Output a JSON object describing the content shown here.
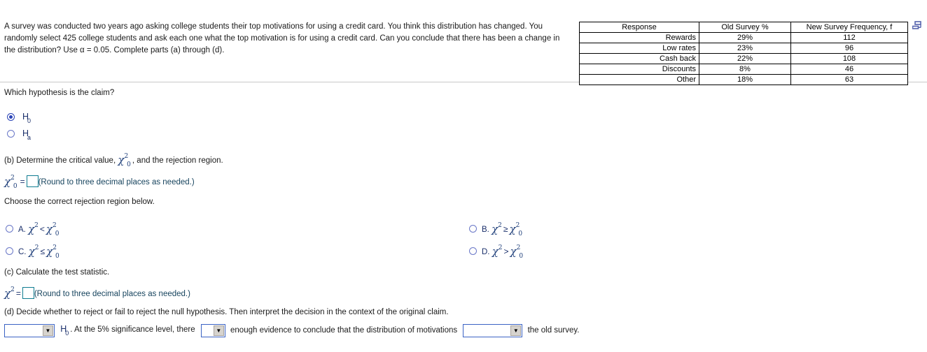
{
  "problem": {
    "statement": "A survey was conducted two years ago asking college students their top motivations for using a credit card. You think this distribution has changed. You randomly select 425 college students and ask each one what the top motivation is for using a credit card. Can you conclude that there has been a change in the distribution? Use α = 0.05. Complete parts (a) through (d)."
  },
  "table": {
    "headers": [
      "Response",
      "Old Survey %",
      "New Survey  Frequency, f"
    ],
    "rows": [
      {
        "response": "Rewards",
        "old_pct": "29%",
        "new_freq": "112"
      },
      {
        "response": "Low rates",
        "old_pct": "23%",
        "new_freq": "96"
      },
      {
        "response": "Cash back",
        "old_pct": "22%",
        "new_freq": "108"
      },
      {
        "response": "Discounts",
        "old_pct": "8%",
        "new_freq": "46"
      },
      {
        "response": "Other",
        "old_pct": "18%",
        "new_freq": "63"
      }
    ],
    "popout_icon": "table-popout-icon"
  },
  "part_a": {
    "prompt": "Which hypothesis is the claim?",
    "options": [
      {
        "label": "H",
        "subscript": "0",
        "selected": true
      },
      {
        "label": "H",
        "subscript": "a",
        "selected": false
      }
    ]
  },
  "part_b": {
    "prompt_pre": "(b) Determine the critical value, ",
    "prompt_post": ", and the rejection region.",
    "critical_symbol": "χ",
    "critical_sup": "2",
    "critical_sub": "0",
    "equals": "=",
    "answer_value": "",
    "hint": "(Round to three decimal places as needed.)",
    "choose_prompt": "Choose the correct rejection region below.",
    "choices": [
      {
        "key": "A.",
        "lhs": "χ",
        "lhs_sup": "2",
        "op": "<",
        "rhs": "χ",
        "rhs_sup": "2",
        "rhs_sub": "0",
        "selected": false
      },
      {
        "key": "B.",
        "lhs": "χ",
        "lhs_sup": "2",
        "op": "≥",
        "rhs": "χ",
        "rhs_sup": "2",
        "rhs_sub": "0",
        "selected": false
      },
      {
        "key": "C.",
        "lhs": "χ",
        "lhs_sup": "2",
        "op": "≤",
        "rhs": "χ",
        "rhs_sup": "2",
        "rhs_sub": "0",
        "selected": false
      },
      {
        "key": "D.",
        "lhs": "χ",
        "lhs_sup": "2",
        "op": ">",
        "rhs": "χ",
        "rhs_sup": "2",
        "rhs_sub": "0",
        "selected": false
      }
    ]
  },
  "part_c": {
    "prompt": "(c) Calculate the test statistic.",
    "symbol": "χ",
    "symbol_sup": "2",
    "equals": "=",
    "answer_value": "",
    "hint": "(Round to three decimal places as needed.)"
  },
  "part_d": {
    "prompt": "(d) Decide whether to reject or fail to reject the null hypothesis. Then interpret the decision in the context of the original claim.",
    "select1_value": "",
    "text1": "H",
    "text1_sub": "0",
    "text2": ". At the 5% significance level, there",
    "select2_value": "",
    "text3": "enough evidence to conclude that the distribution of motivations",
    "select3_value": "",
    "text4": "the old survey."
  },
  "colors": {
    "accent_blue": "#2a44b8",
    "input_border": "#0f7c91",
    "select_border": "#3b63c4",
    "math_text": "#1a2f6b",
    "icon_blue": "#5563ad"
  }
}
